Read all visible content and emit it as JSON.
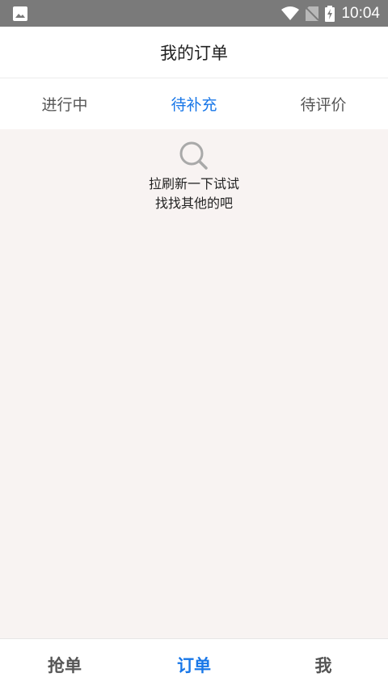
{
  "status_bar": {
    "time": "10:04"
  },
  "header": {
    "title": "我的订单"
  },
  "tabs": [
    {
      "label": "进行中",
      "active": false
    },
    {
      "label": "待补充",
      "active": true
    },
    {
      "label": "待评价",
      "active": false
    }
  ],
  "empty_state": {
    "icon": "search-icon",
    "line1": "拉刷新一下试试",
    "line2": "找找其他的吧"
  },
  "bottom_nav": [
    {
      "label": "抢单",
      "active": false
    },
    {
      "label": "订单",
      "active": true
    },
    {
      "label": "我",
      "active": false
    }
  ],
  "colors": {
    "accent": "#1877e8",
    "status_bar": "#7a7a7a",
    "content_bg": "#f8f3f2"
  }
}
